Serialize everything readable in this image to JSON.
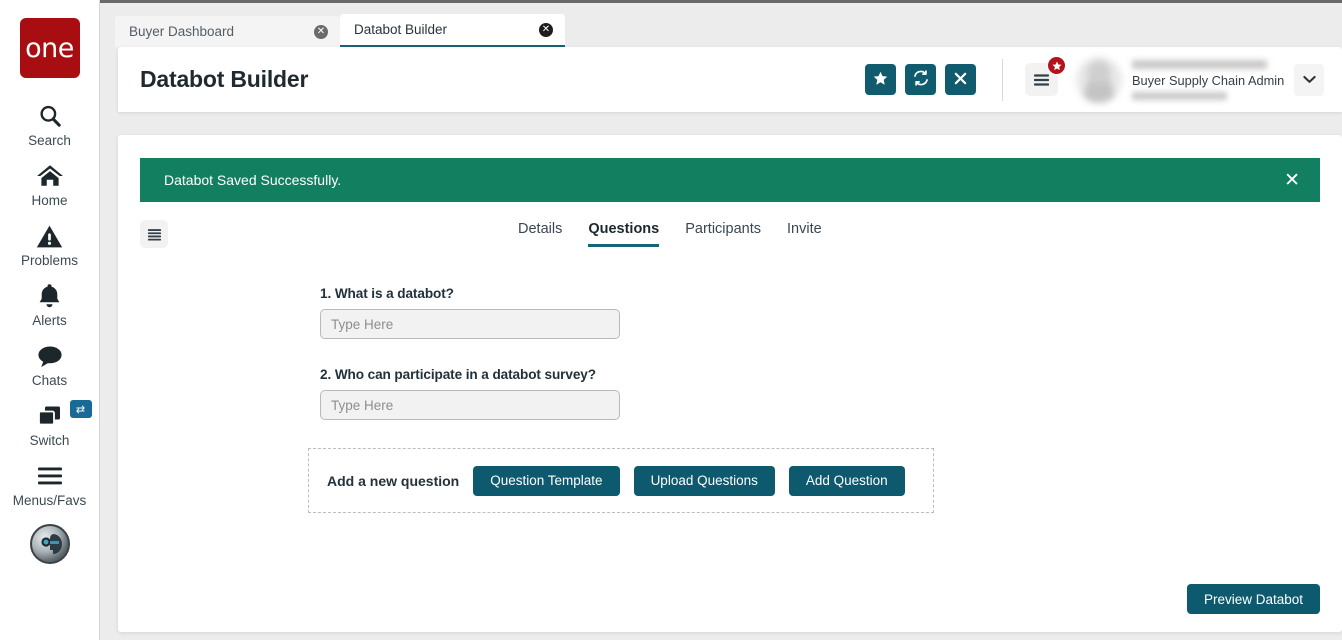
{
  "brand": {
    "logo_text": "one"
  },
  "left_rail": {
    "items": [
      {
        "label": "Search",
        "icon": "search-icon"
      },
      {
        "label": "Home",
        "icon": "home-icon"
      },
      {
        "label": "Problems",
        "icon": "warning-triangle-icon"
      },
      {
        "label": "Alerts",
        "icon": "bell-icon"
      },
      {
        "label": "Chats",
        "icon": "chat-bubble-icon"
      },
      {
        "label": "Switch",
        "icon": "windows-stack-icon",
        "badge_icon": "swap-arrows-icon"
      },
      {
        "label": "Menus/Favs",
        "icon": "hamburger-icon"
      }
    ],
    "assistant_icon": "ai-assistant-icon"
  },
  "browser_tabs": [
    {
      "title": "Buyer Dashboard",
      "active": false,
      "close_icon": "close-circle-icon"
    },
    {
      "title": "Databot Builder",
      "active": true,
      "close_icon": "close-circle-icon"
    }
  ],
  "header": {
    "title": "Databot Builder",
    "actions": [
      {
        "name": "favorite-button",
        "icon": "star-icon"
      },
      {
        "name": "refresh-button",
        "icon": "refresh-icon"
      },
      {
        "name": "close-button",
        "icon": "x-icon"
      }
    ],
    "menu_fav": {
      "icon": "hamburger-icon",
      "badge_icon": "star-icon"
    },
    "user": {
      "role": "Buyer Supply Chain Admin",
      "avatar_icon": "user-avatar-icon",
      "chevron_icon": "chevron-down-icon"
    }
  },
  "banner": {
    "message": "Databot Saved Successfully.",
    "close_icon": "x-icon",
    "color": "#128060"
  },
  "section_nav": {
    "list_toggle_icon": "list-icon",
    "tabs": [
      {
        "label": "Details",
        "active": false
      },
      {
        "label": "Questions",
        "active": true
      },
      {
        "label": "Participants",
        "active": false
      },
      {
        "label": "Invite",
        "active": false
      }
    ]
  },
  "questions": [
    {
      "label": "1. What is a databot?",
      "value": "",
      "placeholder": "Type Here"
    },
    {
      "label": "2. Who can participate in a databot survey?",
      "value": "",
      "placeholder": "Type Here"
    }
  ],
  "add_question_panel": {
    "label": "Add a new question",
    "buttons": [
      {
        "label": "Question Template"
      },
      {
        "label": "Upload Questions"
      },
      {
        "label": "Add Question"
      }
    ]
  },
  "footer": {
    "preview_label": "Preview Databot"
  },
  "colors": {
    "teal_accent": "#0d5a6e",
    "success_green": "#128060",
    "brand_red": "#a80d12",
    "badge_red": "#b3141c"
  }
}
